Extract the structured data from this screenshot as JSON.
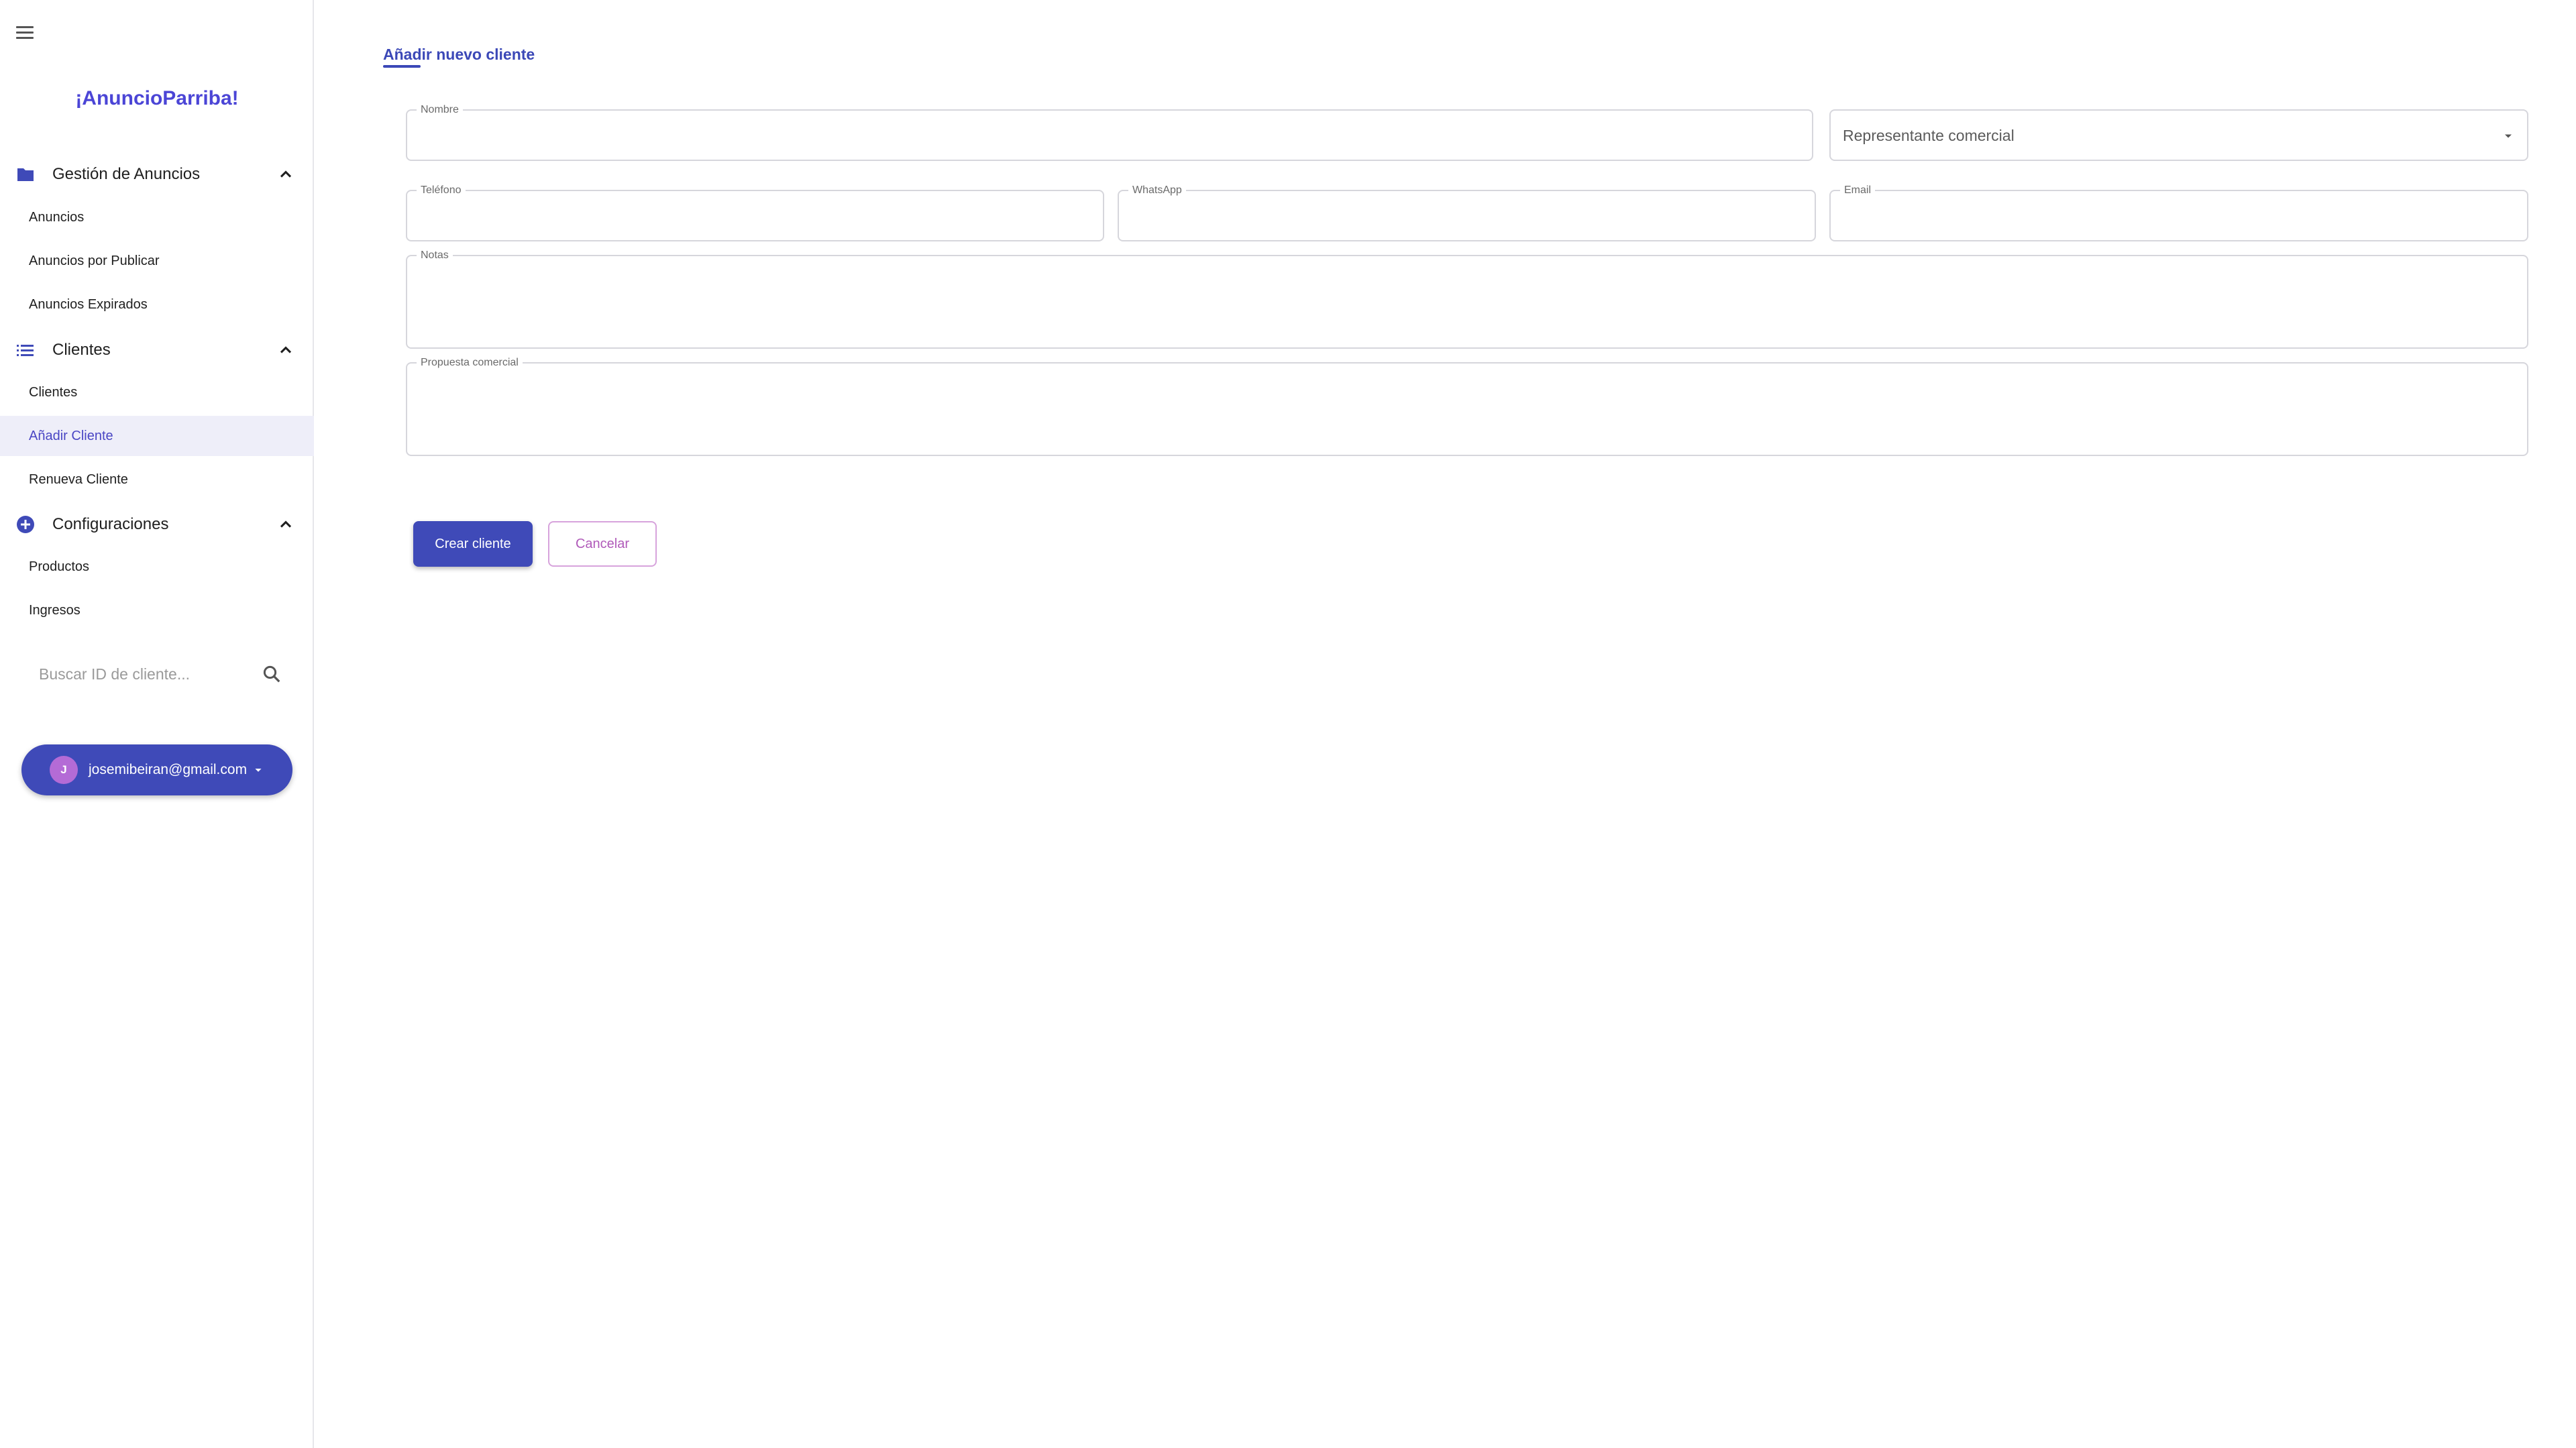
{
  "sidebar": {
    "brand": "¡AnuncioParriba!",
    "groups": [
      {
        "label": "Gestión de Anuncios",
        "icon": "folder-icon",
        "items": [
          "Anuncios",
          "Anuncios por Publicar",
          "Anuncios Expirados"
        ]
      },
      {
        "label": "Clientes",
        "icon": "list-icon",
        "items": [
          "Clientes",
          "Añadir Cliente",
          "Renueva Cliente"
        ]
      },
      {
        "label": "Configuraciones",
        "icon": "plus-circle-icon",
        "items": [
          "Productos",
          "Ingresos"
        ]
      }
    ],
    "active_item": "Añadir Cliente",
    "search": {
      "placeholder": "Buscar ID de cliente..."
    },
    "user": {
      "initial": "J",
      "email": "josemibeiran@gmail.com"
    }
  },
  "main": {
    "tab_label": "Añadir nuevo cliente",
    "fields": {
      "nombre": {
        "label": "Nombre",
        "value": ""
      },
      "representante": {
        "placeholder": "Representante comercial"
      },
      "telefono": {
        "label": "Teléfono",
        "value": ""
      },
      "whatsapp": {
        "label": "WhatsApp",
        "value": ""
      },
      "email": {
        "label": "Email",
        "value": ""
      },
      "notas": {
        "label": "Notas",
        "value": ""
      },
      "propuesta": {
        "label": "Propuesta comercial",
        "value": ""
      }
    },
    "buttons": {
      "create": "Crear cliente",
      "cancel": "Cancelar"
    }
  },
  "colors": {
    "brand": "#4b45d6",
    "primary": "#3f4ab8",
    "active_bg": "#eeeef9",
    "cancel": "#b05ab9",
    "avatar": "#b46bd6"
  }
}
